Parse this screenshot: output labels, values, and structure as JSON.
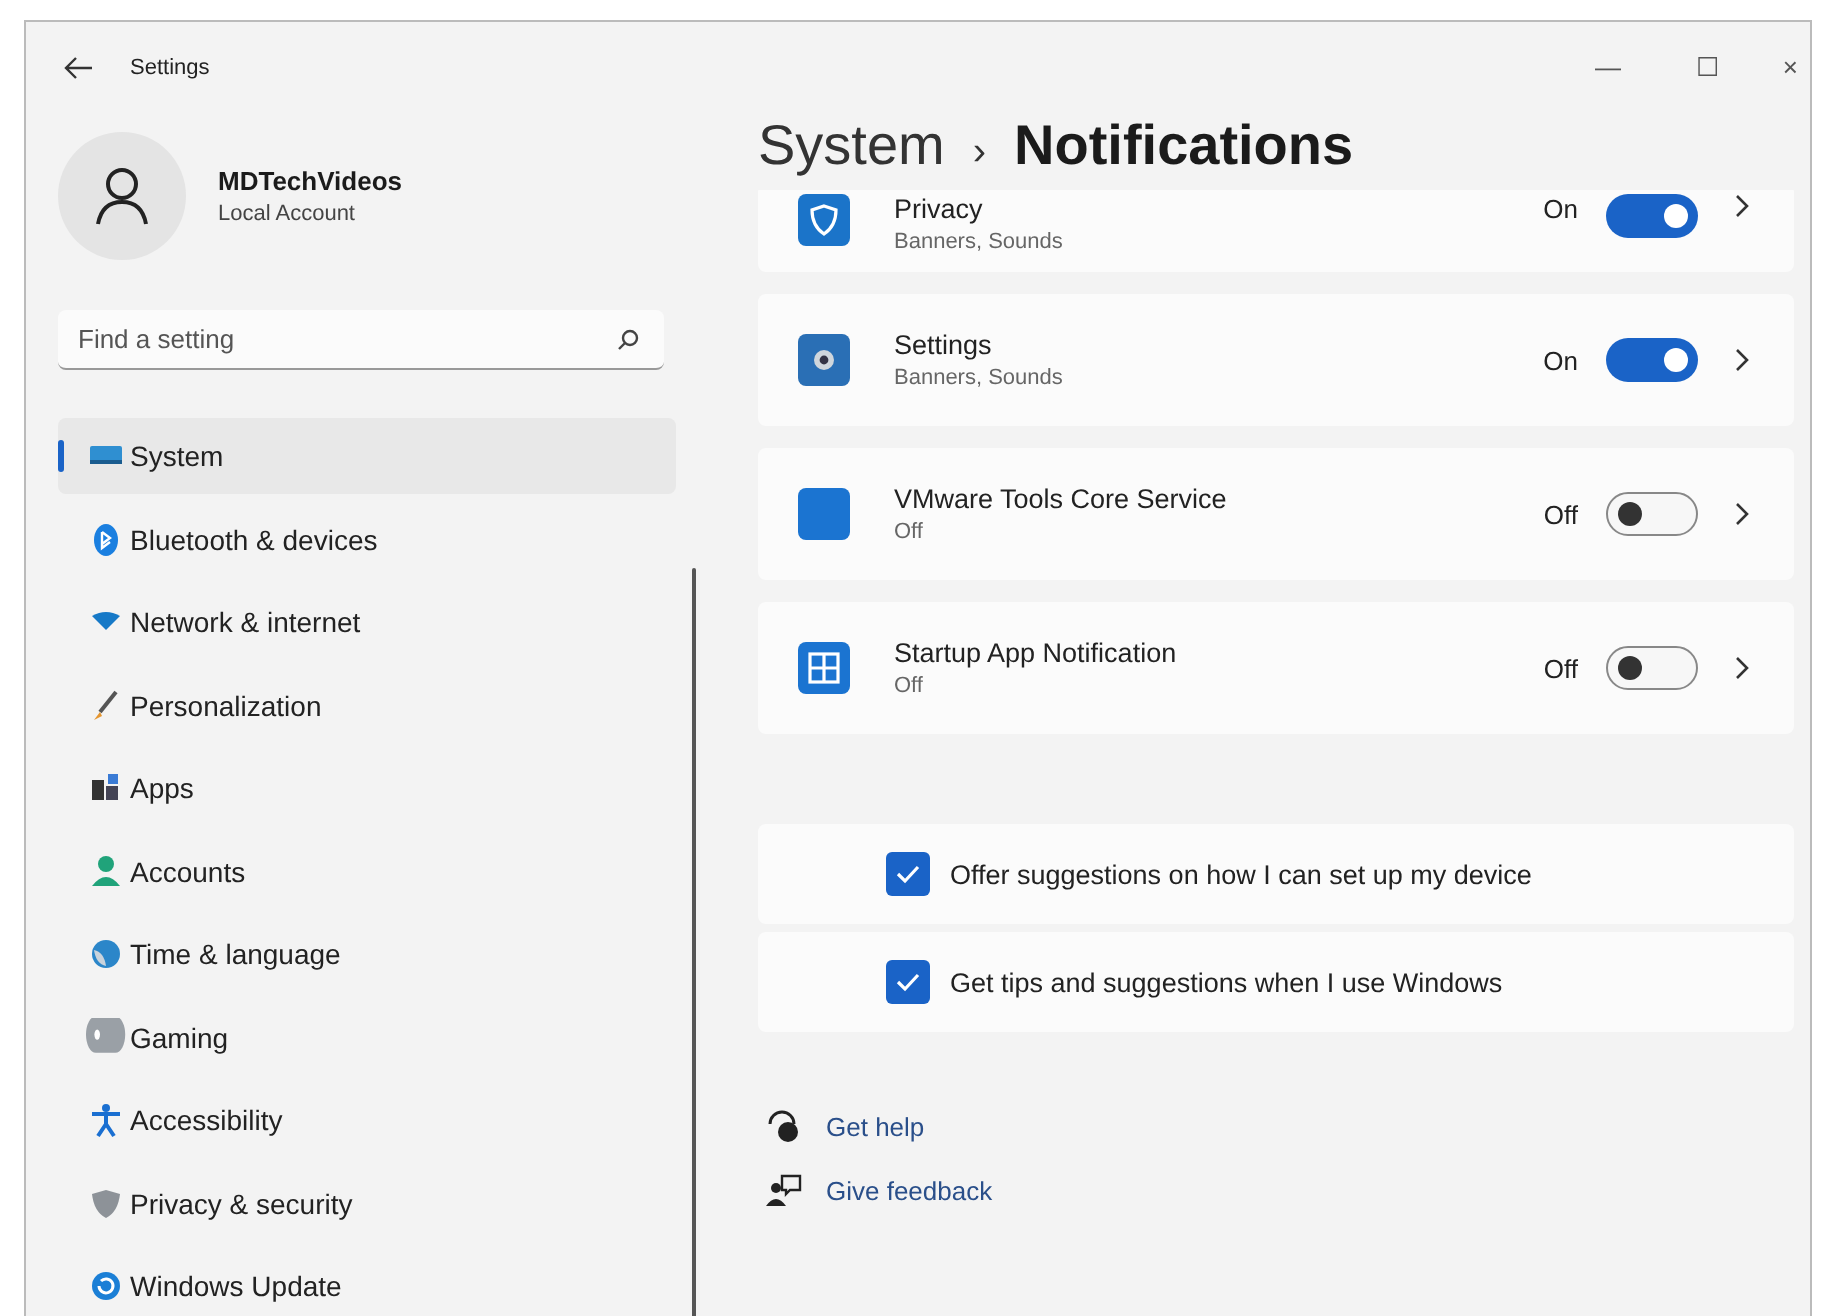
{
  "window": {
    "title": "Settings",
    "controls": [
      "—",
      "☐",
      "×"
    ]
  },
  "account": {
    "name": "MDTechVideos",
    "type": "Local Account"
  },
  "search": {
    "placeholder": "Find a setting"
  },
  "sidebar": {
    "items": [
      {
        "label": "System",
        "selected": true
      },
      {
        "label": "Bluetooth & devices",
        "selected": false
      },
      {
        "label": "Network & internet",
        "selected": false
      },
      {
        "label": "Personalization",
        "selected": false
      },
      {
        "label": "Apps",
        "selected": false
      },
      {
        "label": "Accounts",
        "selected": false
      },
      {
        "label": "Time & language",
        "selected": false
      },
      {
        "label": "Gaming",
        "selected": false
      },
      {
        "label": "Accessibility",
        "selected": false
      },
      {
        "label": "Privacy & security",
        "selected": false
      },
      {
        "label": "Windows Update",
        "selected": false
      }
    ]
  },
  "breadcrumb": {
    "parent": "System",
    "separator": "›",
    "current": "Notifications"
  },
  "apps": [
    {
      "name": "Privacy",
      "detail": "Banners, Sounds",
      "state": "On",
      "on": true
    },
    {
      "name": "Settings",
      "detail": "Banners, Sounds",
      "state": "On",
      "on": true
    },
    {
      "name": "VMware Tools Core Service",
      "detail": "Off",
      "state": "Off",
      "on": false
    },
    {
      "name": "Startup App Notification",
      "detail": "Off",
      "state": "Off",
      "on": false
    }
  ],
  "options": [
    {
      "label": "Offer suggestions on how I can set up my device",
      "checked": true
    },
    {
      "label": "Get tips and suggestions when I use Windows",
      "checked": true
    }
  ],
  "links": [
    "Get help",
    "Give feedback"
  ]
}
